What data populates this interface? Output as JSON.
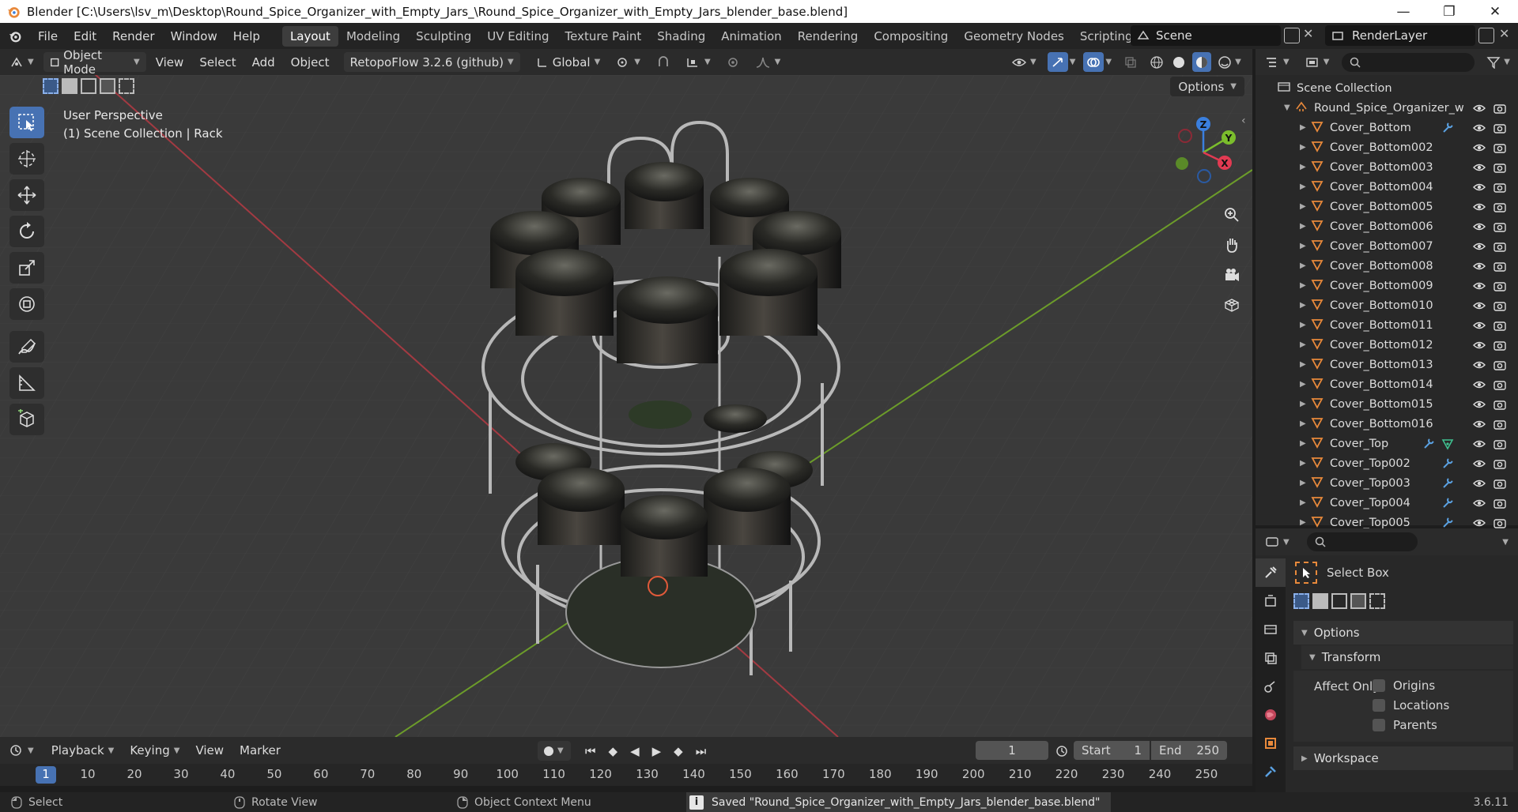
{
  "window": {
    "title": "Blender [C:\\Users\\lsv_m\\Desktop\\Round_Spice_Organizer_with_Empty_Jars_\\Round_Spice_Organizer_with_Empty_Jars_blender_base.blend]",
    "minimize": "—",
    "maximize": "❐",
    "close": "✕"
  },
  "menu": [
    "File",
    "Edit",
    "Render",
    "Window",
    "Help"
  ],
  "workspaces": [
    "Layout",
    "Modeling",
    "Sculpting",
    "UV Editing",
    "Texture Paint",
    "Shading",
    "Animation",
    "Rendering",
    "Compositing",
    "Geometry Nodes",
    "Scripting",
    "+"
  ],
  "active_workspace": "Layout",
  "scene": "Scene",
  "view_layer": "RenderLayer",
  "header": {
    "mode": "Object Mode",
    "menus": [
      "View",
      "Select",
      "Add",
      "Object"
    ],
    "addon": "RetopoFlow 3.2.6 (github)",
    "orientation": "Global",
    "options": "Options"
  },
  "viewport": {
    "perspective": "User Perspective",
    "context": "(1) Scene Collection | Rack",
    "axis_x": "X",
    "axis_y": "Y",
    "axis_z": "Z"
  },
  "outliner": {
    "root": "Scene Collection",
    "collection": "Round_Spice_Organizer_w",
    "items": [
      "Cover_Bottom",
      "Cover_Bottom002",
      "Cover_Bottom003",
      "Cover_Bottom004",
      "Cover_Bottom005",
      "Cover_Bottom006",
      "Cover_Bottom007",
      "Cover_Bottom008",
      "Cover_Bottom009",
      "Cover_Bottom010",
      "Cover_Bottom011",
      "Cover_Bottom012",
      "Cover_Bottom013",
      "Cover_Bottom014",
      "Cover_Bottom015",
      "Cover_Bottom016",
      "Cover_Top",
      "Cover_Top002",
      "Cover_Top003",
      "Cover_Top004",
      "Cover_Top005"
    ]
  },
  "properties": {
    "tool_name": "Select Box",
    "options_panel": "Options",
    "transform_panel": "Transform",
    "affect_only": "Affect Only",
    "checkboxes": [
      "Origins",
      "Locations",
      "Parents"
    ],
    "workspace_panel": "Workspace"
  },
  "timeline": {
    "menus": [
      "Playback",
      "Keying",
      "View",
      "Marker"
    ],
    "current_frame": "1",
    "start_label": "Start",
    "start": "1",
    "end_label": "End",
    "end": "250",
    "ruler": [
      "1",
      "10",
      "20",
      "30",
      "40",
      "50",
      "60",
      "70",
      "80",
      "90",
      "100",
      "110",
      "120",
      "130",
      "140",
      "150",
      "160",
      "170",
      "180",
      "190",
      "200",
      "210",
      "220",
      "230",
      "240",
      "250"
    ]
  },
  "status": {
    "select": "Select",
    "rotate": "Rotate View",
    "context_menu": "Object Context Menu",
    "message": "Saved \"Round_Spice_Organizer_with_Empty_Jars_blender_base.blend\"",
    "version": "3.6.11"
  },
  "colors": {
    "accent": "#4772b3",
    "object_icon": "#e8893b",
    "axis_x": "#e23a52",
    "axis_y": "#7bbd2c",
    "axis_z": "#3a7fde"
  }
}
